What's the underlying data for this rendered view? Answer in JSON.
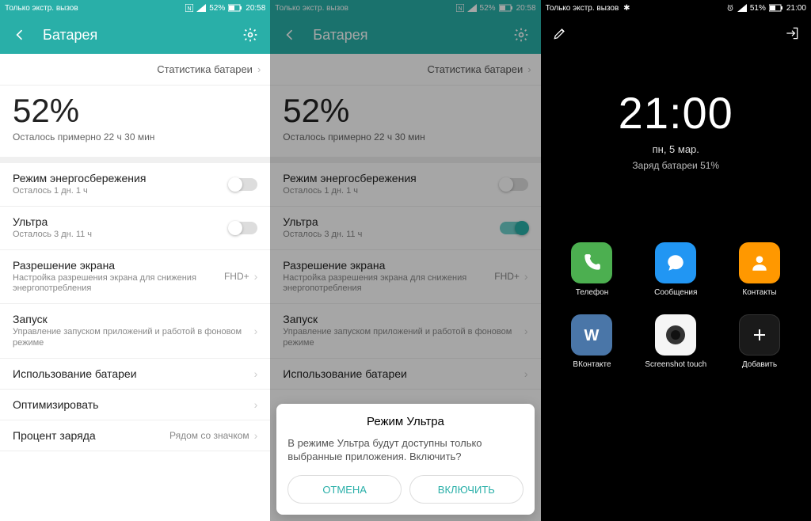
{
  "screens": [
    {
      "status": {
        "left": "Только экстр. вызов",
        "right": {
          "pct": "52%",
          "time": "20:58"
        }
      },
      "header": {
        "title": "Батарея"
      },
      "stats_link": "Статистика батареи",
      "main": {
        "percent": "52%",
        "estimate": "Осталось примерно 22 ч 30 мин"
      },
      "rows": {
        "power_save": {
          "title": "Режим энергосбережения",
          "sub": "Осталось 1 дн. 1 ч"
        },
        "ultra": {
          "title": "Ультра",
          "sub": "Осталось 3 дн. 11 ч"
        },
        "resolution": {
          "title": "Разрешение экрана",
          "sub": "Настройка разрешения экрана для снижения энергопотребления",
          "value": "FHD+"
        },
        "launch": {
          "title": "Запуск",
          "sub": "Управление запуском приложений и работой в фоновом режиме"
        },
        "usage": {
          "title": "Использование батареи"
        },
        "optimize": {
          "title": "Оптимизировать"
        },
        "percent_row": {
          "title": "Процент заряда",
          "value": "Рядом со значком"
        }
      }
    },
    {
      "status": {
        "left": "Только экстр. вызов",
        "right": {
          "pct": "52%",
          "time": "20:58"
        }
      },
      "header": {
        "title": "Батарея"
      },
      "stats_link": "Статистика батареи",
      "main": {
        "percent": "52%",
        "estimate": "Осталось примерно 22 ч 30 мин"
      },
      "rows": {
        "power_save": {
          "title": "Режим энергосбережения",
          "sub": "Осталось 1 дн. 1 ч"
        },
        "ultra": {
          "title": "Ультра",
          "sub": "Осталось 3 дн. 11 ч"
        },
        "resolution": {
          "title": "Разрешение экрана",
          "sub": "Настройка разрешения экрана для снижения энергопотребления",
          "value": "FHD+"
        },
        "launch": {
          "title": "Запуск",
          "sub": "Управление запуском приложений и работой в фоновом режиме"
        },
        "usage": {
          "title": "Использование батареи"
        }
      },
      "dialog": {
        "title": "Режим Ультра",
        "body": "В режиме Ультра будут доступны только выбранные приложения. Включить?",
        "cancel": "ОТМЕНА",
        "ok": "ВКЛЮЧИТЬ"
      }
    },
    {
      "status": {
        "left": "Только экстр. вызов",
        "right": {
          "pct": "51%",
          "time": "21:00"
        }
      },
      "clock": {
        "time": "21:00",
        "date": "пн, 5 мар.",
        "batt": "Заряд батареи 51%"
      },
      "apps": [
        {
          "name": "Телефон"
        },
        {
          "name": "Сообщения"
        },
        {
          "name": "Контакты"
        },
        {
          "name": "ВКонтакте"
        },
        {
          "name": "Screenshot touch"
        },
        {
          "name": "Добавить"
        }
      ]
    }
  ]
}
